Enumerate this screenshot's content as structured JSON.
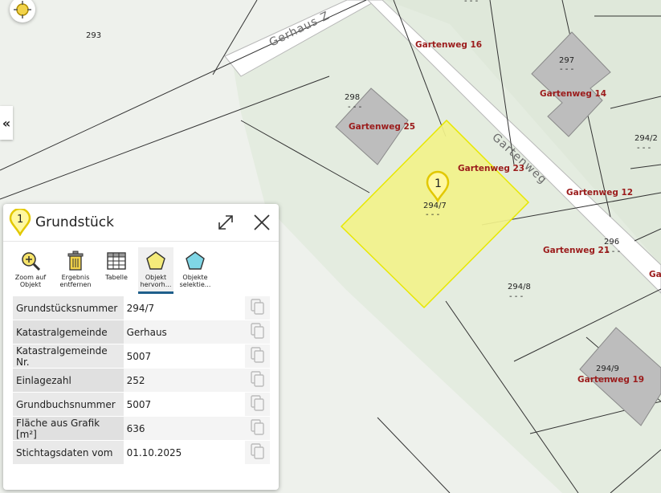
{
  "map": {
    "parcels": [
      "293",
      "298",
      "297",
      "294/2",
      "296",
      "294/8",
      "294/9"
    ],
    "parcel_dashes": "- - -",
    "selected_parcel_label": "294/7",
    "streets": [
      "Gerhaus Z",
      "Gartenweg"
    ],
    "addresses": [
      "Gartenweg 16",
      "Gartenweg 14",
      "Gartenweg 25",
      "Gartenweg 23",
      "Gartenweg 12",
      "Gartenweg 21",
      "Gartenweg 19",
      "Ga"
    ],
    "marker_number": "1",
    "highlight_color": "#f2f28a",
    "address_color": "#9b1b1b"
  },
  "side_toggle": {
    "label": "«"
  },
  "panel": {
    "marker_number": "1",
    "title": "Grundstück",
    "toolbar": [
      {
        "label": "Zoom auf Objekt",
        "icon": "zoom-in-icon"
      },
      {
        "label": "Ergebnis entfernen",
        "icon": "trash-icon"
      },
      {
        "label": "Tabelle",
        "icon": "table-icon"
      },
      {
        "label": "Objekt hervorh...",
        "icon": "highlight-polygon-icon",
        "active": true
      },
      {
        "label": "Objekte selektie...",
        "icon": "select-polygon-icon"
      }
    ],
    "attributes": [
      {
        "key": "Grundstücksnummer",
        "value": "294/7"
      },
      {
        "key": "Katastralgemeinde",
        "value": "Gerhaus"
      },
      {
        "key": "Katastralgemeinde Nr.",
        "value": "5007"
      },
      {
        "key": "Einlagezahl",
        "value": "252"
      },
      {
        "key": "Grundbuchsnummer",
        "value": "5007"
      },
      {
        "key": "Fläche aus Grafik [m²]",
        "value": "636"
      },
      {
        "key": "Stichtagsdaten vom",
        "value": "01.10.2025"
      }
    ]
  }
}
